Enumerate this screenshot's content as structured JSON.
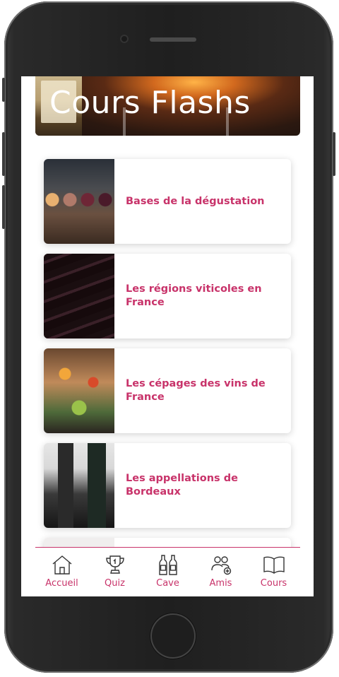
{
  "hero": {
    "title": "Cours Flashs"
  },
  "courses": [
    {
      "title": "Bases de la dégustation"
    },
    {
      "title": "Les régions viticoles en France"
    },
    {
      "title": "Les cépages des vins de France"
    },
    {
      "title": "Les appellations de Bordeaux"
    }
  ],
  "tabbar": {
    "items": [
      {
        "label": "Accueil",
        "icon": "home-icon"
      },
      {
        "label": "Quiz",
        "icon": "trophy-icon"
      },
      {
        "label": "Cave",
        "icon": "wine-bottles-icon"
      },
      {
        "label": "Amis",
        "icon": "friends-icon"
      },
      {
        "label": "Cours",
        "icon": "book-icon"
      }
    ],
    "accent": "#c8336a"
  }
}
